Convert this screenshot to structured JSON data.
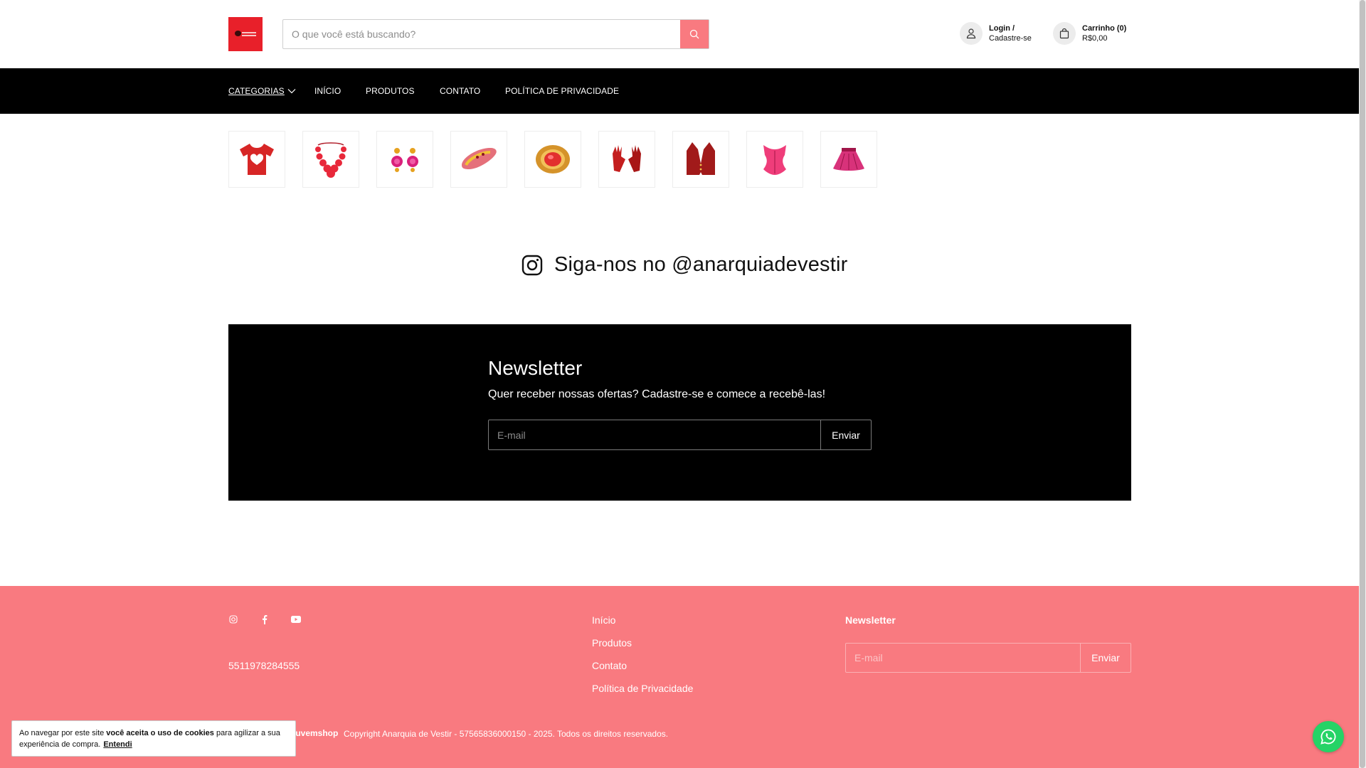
{
  "header": {
    "logo_alt": "Anarquia de Vestir",
    "search_placeholder": "O que você está buscando?",
    "account_line1": "Login /",
    "account_line2": "Cadastre-se",
    "cart_line1": "Carrinho (0)",
    "cart_line2": "R$0,00"
  },
  "nav": {
    "items": [
      {
        "label": "CATEGORIAS"
      },
      {
        "label": "INÍCIO"
      },
      {
        "label": "PRODUTOS"
      },
      {
        "label": "CONTATO"
      },
      {
        "label": "POLÍTICA DE PRIVACIDADE"
      }
    ]
  },
  "categories": [
    {
      "icon": "tshirt-heart-icon"
    },
    {
      "icon": "necklace-icon"
    },
    {
      "icon": "earrings-icon"
    },
    {
      "icon": "bracelet-icon"
    },
    {
      "icon": "brooch-icon"
    },
    {
      "icon": "gloves-icon"
    },
    {
      "icon": "vest-icon"
    },
    {
      "icon": "corset-icon"
    },
    {
      "icon": "skirt-icon"
    }
  ],
  "instagram": {
    "text": "Siga-nos no @anarquiadevestir"
  },
  "newsletter": {
    "title": "Newsletter",
    "subtitle": "Quer receber nossas ofertas? Cadastre-se e comece a recebê-las!",
    "email_placeholder": "E-mail",
    "button": "Enviar"
  },
  "footer": {
    "phone": "5511978284555",
    "links": [
      "Início",
      "Produtos",
      "Contato",
      "Política de Privacidade"
    ],
    "newsletter_title": "Newsletter",
    "email_placeholder": "E-mail",
    "button": "Enviar",
    "platform": "nuvemshop",
    "copyright": "Copyright Anarquia de Vestir - 57565836000150 - 2025. Todos os direitos reservados."
  },
  "cookie": {
    "text1": "Ao navegar por este site ",
    "text_bold": "você aceita o uso de cookies",
    "text2": " para agilizar a sua experiência de compra.",
    "link": "Entendi"
  },
  "colors": {
    "accent": "#f97a80",
    "nav_bg": "#000000",
    "logo_bg": "#e8202a",
    "whatsapp": "#25d366"
  }
}
